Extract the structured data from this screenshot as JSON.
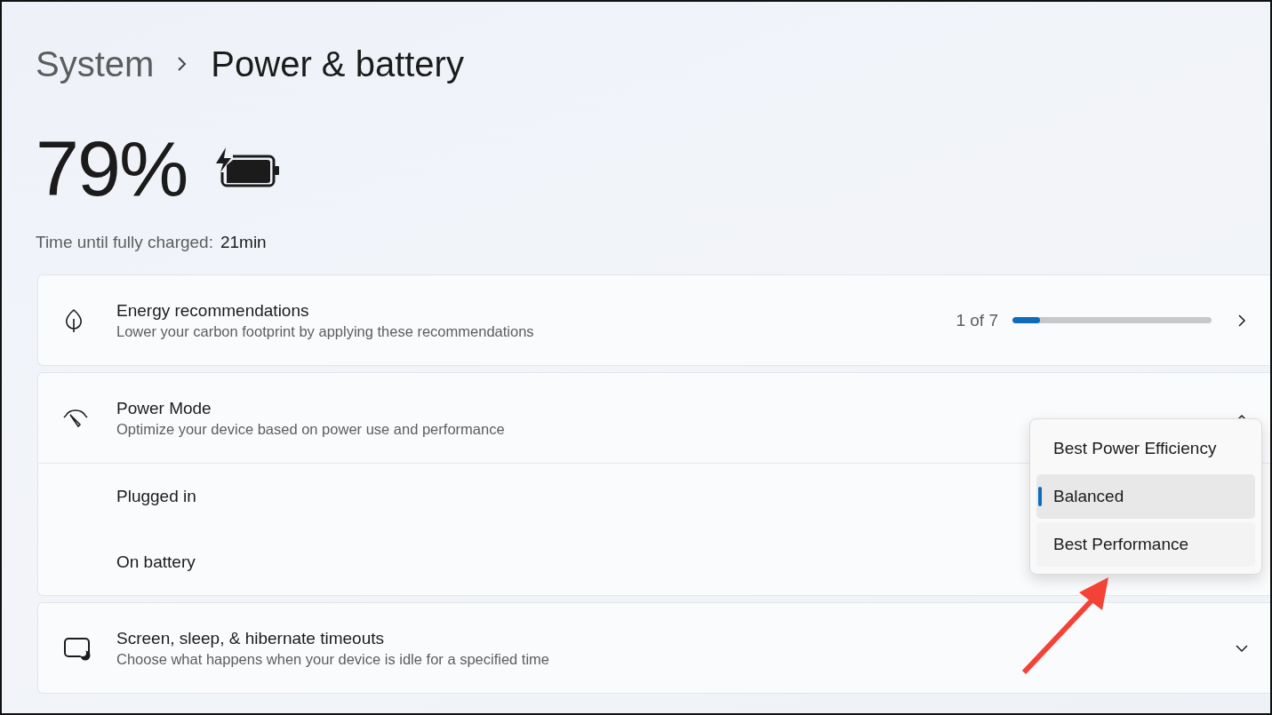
{
  "breadcrumb": [
    {
      "label": "System"
    },
    {
      "label": "Power & battery"
    }
  ],
  "battery": {
    "percent": "79%"
  },
  "charge_time": {
    "label": "Time until fully charged:",
    "value": "21min"
  },
  "cards": [
    {
      "kind": "link",
      "title": "Energy recommendations",
      "subtitle": "Lower your carbon footprint by applying these recommendations",
      "progress": {
        "text": "1 of 7",
        "level": 0.14
      }
    },
    {
      "kind": "expander",
      "expanded": true,
      "title": "Power Mode",
      "subtitle": "Optimize your device based on power use and performance",
      "rows": [
        {
          "label": "Plugged in"
        },
        {
          "label": "On battery"
        }
      ]
    },
    {
      "kind": "expander",
      "expanded": false,
      "title": "Screen, sleep, & hibernate timeouts",
      "subtitle": "Choose what happens when your device is idle for a specified time"
    }
  ],
  "menu": {
    "items": [
      {
        "label": "Best Power Efficiency",
        "selected": false
      },
      {
        "label": "Balanced",
        "selected": true
      },
      {
        "label": "Best Performance",
        "selected": false
      }
    ]
  }
}
